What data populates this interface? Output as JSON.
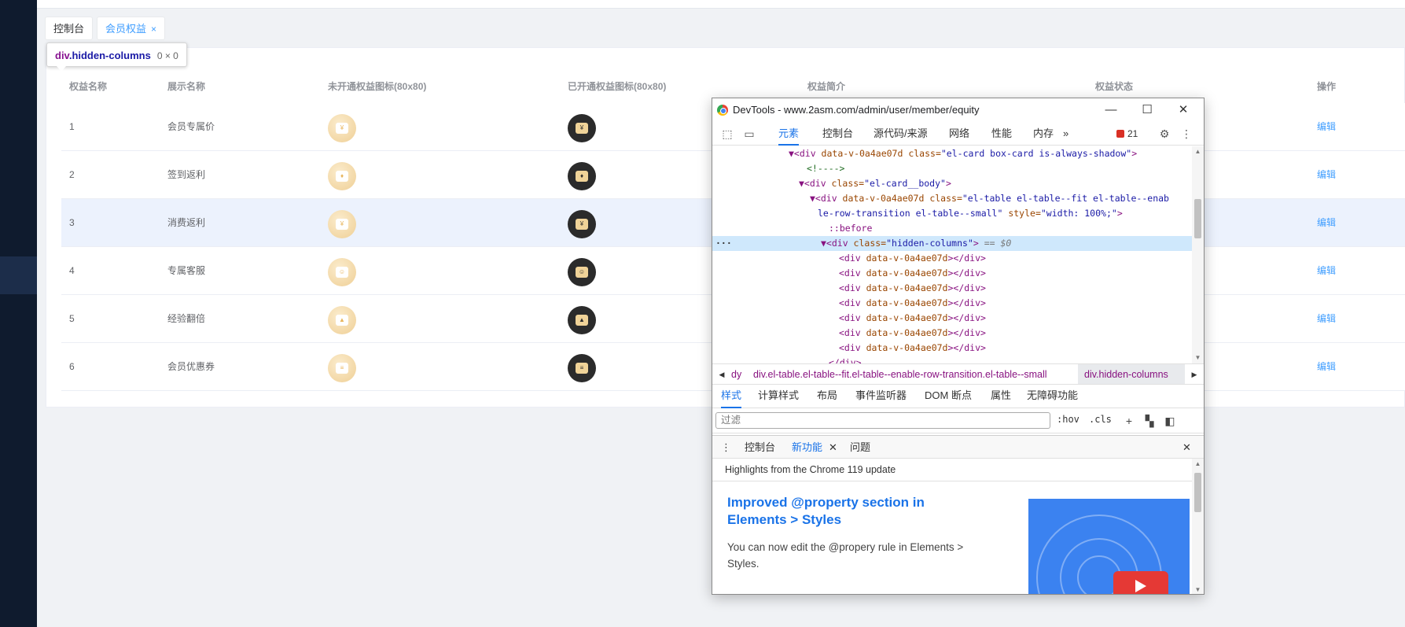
{
  "tags": [
    {
      "label": "控制台"
    },
    {
      "label": "会员权益",
      "close": "×"
    }
  ],
  "tooltip": {
    "selector_tag": "div",
    "selector_class": ".hidden-columns",
    "size": "0 × 0"
  },
  "table": {
    "headers": [
      "权益名称",
      "展示名称",
      "未开通权益图标(80x80)",
      "已开通权益图标(80x80)",
      "权益简介",
      "权益状态",
      "操作"
    ],
    "rows": [
      {
        "id": "1",
        "name": "会员专属价",
        "glyph": "¥",
        "action": "编辑"
      },
      {
        "id": "2",
        "name": "签到返利",
        "glyph": "♦",
        "action": "编辑"
      },
      {
        "id": "3",
        "name": "消费返利",
        "glyph": "¥",
        "action": "编辑"
      },
      {
        "id": "4",
        "name": "专属客服",
        "glyph": "☺",
        "action": "编辑"
      },
      {
        "id": "5",
        "name": "经验翻倍",
        "glyph": "▲",
        "action": "编辑"
      },
      {
        "id": "6",
        "name": "会员优惠券",
        "glyph": "≡",
        "action": "编辑"
      }
    ]
  },
  "devtools": {
    "title": "DevTools - www.2asm.com/admin/user/member/equity",
    "window_buttons": {
      "minimize": "—",
      "maximize": "☐",
      "close": "✕"
    },
    "tabs": [
      "元素",
      "控制台",
      "源代码/来源",
      "网络",
      "性能",
      "内存"
    ],
    "more_tabs": "»",
    "issues_count": "21",
    "dom_lines": {
      "l1_pre": "▼<div ",
      "l1_a1": "data-v-0a4ae07d",
      "l1_a2": " class=",
      "l1_v2": "\"el-card box-card is-always-shadow\"",
      "l1_end": ">",
      "l2": "<!---->",
      "l3_pre": "▼<div ",
      "l3_a1": "class=",
      "l3_v1": "\"el-card__body\"",
      "l3_end": ">",
      "l4_pre": "▼<div ",
      "l4_a1": "data-v-0a4ae07d",
      "l4_a2": " class=",
      "l4_v2": "\"el-table el-table--fit el-table--enab",
      "l5_v": "le-row-transition el-table--small\"",
      "l5_a": " style=",
      "l5_v2": "\"width: 100%;\"",
      "l5_end": ">",
      "l6": "::before",
      "l7_pre": "▼<div ",
      "l7_a1": "class=",
      "l7_v1": "\"hidden-columns\"",
      "l7_end": ">",
      "l7_eq": " == $0",
      "child_open": "<div ",
      "child_attr": "data-v-0a4ae07d",
      "child_close": "></div>",
      "l15": "</div>"
    },
    "crumbs": {
      "c1": "dy",
      "c2": "div.el-table.el-table--fit.el-table--enable-row-transition.el-table--small",
      "c3": "div.hidden-columns"
    },
    "style_tabs": [
      "样式",
      "计算样式",
      "布局",
      "事件监听器",
      "DOM 断点",
      "属性",
      "无障碍功能"
    ],
    "filter_placeholder": "过滤",
    "hov": ":hov",
    "cls": ".cls",
    "drawer_tabs": [
      "控制台",
      "新功能",
      "问题"
    ],
    "whatsnew": {
      "header": "Highlights from the Chrome 119 update",
      "title": "Improved @property section in Elements > Styles",
      "body": "You can now edit the @propery rule in Elements > Styles."
    }
  }
}
